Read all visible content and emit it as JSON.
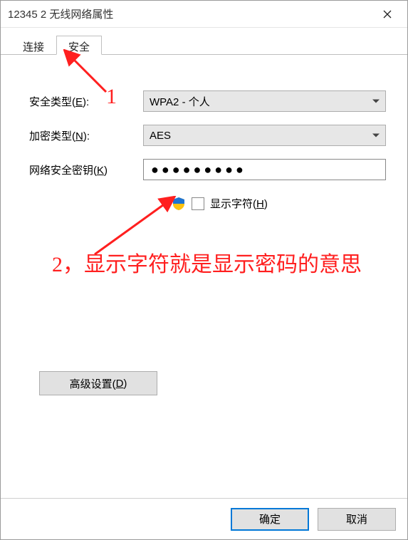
{
  "window": {
    "title": "12345 2 无线网络属性"
  },
  "tabs": {
    "connect": "连接",
    "security": "安全"
  },
  "form": {
    "security_type_label_pre": "安全类型(",
    "security_type_hot": "E",
    "security_type_label_post": "):",
    "security_type_value": "WPA2 - 个人",
    "encryption_label_pre": "加密类型(",
    "encryption_hot": "N",
    "encryption_label_post": "):",
    "encryption_value": "AES",
    "key_label_pre": "网络安全密钥(",
    "key_hot": "K",
    "key_label_post": ")",
    "key_value": "●●●●●●●●●",
    "show_chars_pre": "显示字符(",
    "show_chars_hot": "H",
    "show_chars_post": ")",
    "advanced_pre": "高级设置(",
    "advanced_hot": "D",
    "advanced_post": ")"
  },
  "buttons": {
    "ok": "确定",
    "cancel": "取消"
  },
  "annotations": {
    "a1": "1",
    "a2": "2，显示字符就是显示密码的意思"
  }
}
